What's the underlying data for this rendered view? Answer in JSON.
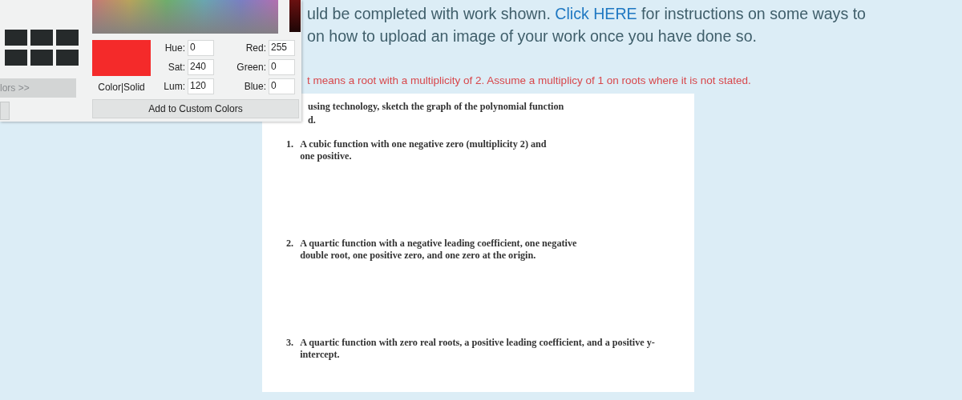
{
  "instructions": [
    [
      {
        "kind": "text",
        "text": "uld be completed with work shown."
      },
      {
        "kind": "link",
        "text": "Click HERE"
      },
      {
        "kind": "text",
        "text": "for instructions on some ways to"
      }
    ],
    [
      {
        "kind": "text",
        "text": "on how to upload an image of your work once you have done so."
      }
    ]
  ],
  "note": "t means a root with a multiplicity of 2.  Assume a multiplicy of 1 on roots where it is not stated.",
  "worksheet": {
    "intro": [
      "using technology, sketch the graph of the polynomial function",
      "d."
    ],
    "questions": [
      {
        "number": "1.",
        "text": "A cubic function with one negative zero (multiplicity 2) and one positive."
      },
      {
        "number": "2.",
        "text": "A quartic function with a negative leading coefficient, one negative double root, one positive zero, and one zero at the origin."
      },
      {
        "number": "3.",
        "text": "A quartic function with zero real roots, a positive leading coefficient, and a positive y-intercept."
      }
    ]
  },
  "color_dialog": {
    "custom_colors_button": "lors >>",
    "preview_label": "Color|Solid",
    "fields": [
      {
        "label": "Hue:",
        "value": "0"
      },
      {
        "label": "Red:",
        "value": "255"
      },
      {
        "label": "Sat:",
        "value": "240"
      },
      {
        "label": "Green:",
        "value": "0"
      },
      {
        "label": "Lum:",
        "value": "120"
      },
      {
        "label": "Blue:",
        "value": "0"
      }
    ],
    "add_button": "Add to Custom Colors"
  }
}
